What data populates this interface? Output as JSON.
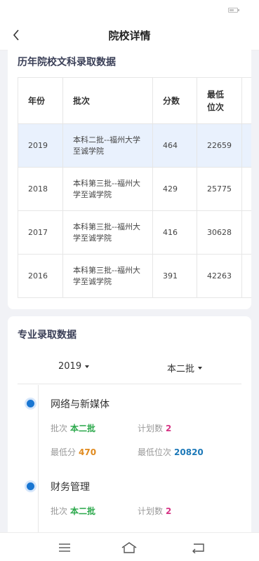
{
  "header": {
    "title": "院校详情"
  },
  "admission_history": {
    "title": "历年院校文科录取数据",
    "columns": [
      "年份",
      "批次",
      "分数",
      "最低\n位次"
    ],
    "rows": [
      {
        "year": "2019",
        "batch": "本科二批--福州大学至诚学院",
        "score": "464",
        "min_rank": "22659",
        "highlight": true
      },
      {
        "year": "2018",
        "batch": "本科第三批--福州大学至诚学院",
        "score": "429",
        "min_rank": "25775",
        "highlight": false
      },
      {
        "year": "2017",
        "batch": "本科第三批--福州大学至诚学院",
        "score": "416",
        "min_rank": "30628",
        "highlight": false
      },
      {
        "year": "2016",
        "batch": "本科第三批--福州大学至诚学院",
        "score": "391",
        "min_rank": "42263",
        "highlight": false
      }
    ]
  },
  "major_admission": {
    "title": "专业录取数据",
    "year_select": "2019",
    "batch_select": "本二批",
    "labels": {
      "batch": "批次",
      "plan": "计划数",
      "min_score": "最低分",
      "min_rank": "最低位次"
    },
    "majors": [
      {
        "name": "网络与新媒体",
        "batch": "本二批",
        "plan": "2",
        "min_score": "470",
        "min_rank": "20820"
      },
      {
        "name": "财务管理",
        "batch": "本二批",
        "plan": "2"
      }
    ]
  },
  "icons": [
    "back-arrow-icon",
    "battery-icon",
    "menu-icon",
    "home-icon",
    "return-icon"
  ]
}
